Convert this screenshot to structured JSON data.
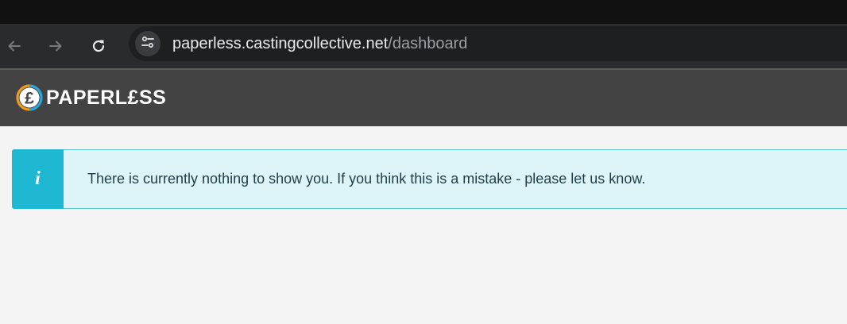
{
  "browser": {
    "url_host": "paperless.castingcollective.net",
    "url_path": "/dashboard",
    "icons": {
      "back": "arrow-left-icon",
      "forward": "arrow-right-icon",
      "reload": "reload-icon",
      "site_info": "tune-icon"
    }
  },
  "app": {
    "brand_name": "PAPERL£SS",
    "logo_icon": "pound-sign-icon"
  },
  "alert": {
    "icon_glyph": "i",
    "message": "There is currently nothing to show you. If you think this is a mistake - please let us know."
  },
  "colors": {
    "alert_accent": "#1fb8d2",
    "alert_background": "#ddf5f8",
    "logo_orange": "#f39a1c",
    "logo_blue": "#2aa6d8",
    "app_bar": "#434343"
  }
}
